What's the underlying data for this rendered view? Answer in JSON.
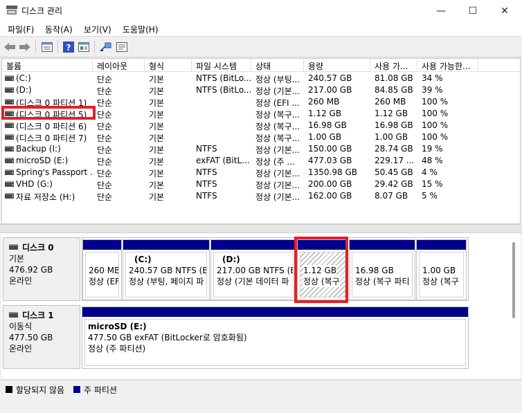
{
  "window": {
    "title": "디스크 관리",
    "minimize": "—",
    "maximize": "☐",
    "close": "✕"
  },
  "menu": [
    "파일(F)",
    "동작(A)",
    "보기(V)",
    "도움말(H)"
  ],
  "toolbar": {
    "icons": [
      "back-icon",
      "forward-icon",
      "properties-icon",
      "help-icon",
      "view-icon",
      "connect-icon",
      "console-icon"
    ]
  },
  "list": {
    "columns": [
      "볼륨",
      "레이아웃",
      "형식",
      "파일 시스템",
      "상태",
      "용량",
      "사용 가...",
      "사용 가능한..."
    ],
    "rows": [
      [
        "(C:)",
        "단순",
        "기본",
        "NTFS (BitLo...",
        "정상 (부팅...",
        "240.57 GB",
        "81.08 GB",
        "34 %"
      ],
      [
        "(D:)",
        "단순",
        "기본",
        "NTFS (BitLo...",
        "정상 (기본...",
        "217.00 GB",
        "84.85 GB",
        "39 %"
      ],
      [
        "(디스크 0 파티션 1)",
        "단순",
        "기본",
        "",
        "정상 (EFI ...",
        "260 MB",
        "260 MB",
        "100 %"
      ],
      [
        "(디스크 0 파티션 5)",
        "단순",
        "기본",
        "",
        "정상 (복구...",
        "1.12 GB",
        "1.12 GB",
        "100 %"
      ],
      [
        "(디스크 0 파티션 6)",
        "단순",
        "기본",
        "",
        "정상 (복구...",
        "16.98 GB",
        "16.98 GB",
        "100 %"
      ],
      [
        "(디스크 0 파티션 7)",
        "단순",
        "기본",
        "",
        "정상 (복구...",
        "1.00 GB",
        "1.00 GB",
        "100 %"
      ],
      [
        "Backup (I:)",
        "단순",
        "기본",
        "NTFS",
        "정상 (기본...",
        "150.00 GB",
        "28.74 GB",
        "19 %"
      ],
      [
        "microSD (E:)",
        "단순",
        "기본",
        "exFAT (BitL...",
        "정상 (주 ...",
        "477.03 GB",
        "229.17 ...",
        "48 %"
      ],
      [
        "Spring's Passport ...",
        "단순",
        "기본",
        "NTFS",
        "정상 (기본...",
        "1350.98 GB",
        "50.45 GB",
        "4 %"
      ],
      [
        "VHD (G:)",
        "단순",
        "기본",
        "NTFS",
        "정상 (기본...",
        "200.00 GB",
        "29.42 GB",
        "15 %"
      ],
      [
        "자료 저장소 (H:)",
        "단순",
        "기본",
        "NTFS",
        "정상 (기본...",
        "162.00 GB",
        "8.07 GB",
        "5 %"
      ]
    ],
    "highlighted_row": 3
  },
  "disks": [
    {
      "name": "디스크 0",
      "type": "기본",
      "size": "476.92 GB",
      "status": "온라인",
      "partitions": [
        {
          "title": "",
          "line1": "260 MB",
          "line2": "정상 (EFI"
        },
        {
          "title": "(C:)",
          "line1": "240.57 GB NTFS (Bit",
          "line2": "정상 (부팅, 페이지 파"
        },
        {
          "title": "(D:)",
          "line1": "217.00 GB NTFS (Bit",
          "line2": "정상 (기본 데이터 파"
        },
        {
          "title": "",
          "line1": "1.12 GB",
          "line2": "정상 (복구"
        },
        {
          "title": "",
          "line1": "16.98 GB",
          "line2": "정상 (복구 파티"
        },
        {
          "title": "",
          "line1": "1.00 GB",
          "line2": "정상 (복구"
        }
      ]
    },
    {
      "name": "디스크 1",
      "type": "이동식",
      "size": "477.50 GB",
      "status": "온라인",
      "partitions": [
        {
          "title": "microSD  (E:)",
          "line1": "477.50 GB exFAT (BitLocker로 암호화됨)",
          "line2": "정상 (주 파티션)"
        }
      ]
    }
  ],
  "legend": [
    {
      "label": "할당되지 않음",
      "color": "#000000"
    },
    {
      "label": "주 파티션",
      "color": "#00008b"
    }
  ],
  "colors": {
    "partition_bar": "#00008b",
    "highlight": "#e0202a"
  }
}
